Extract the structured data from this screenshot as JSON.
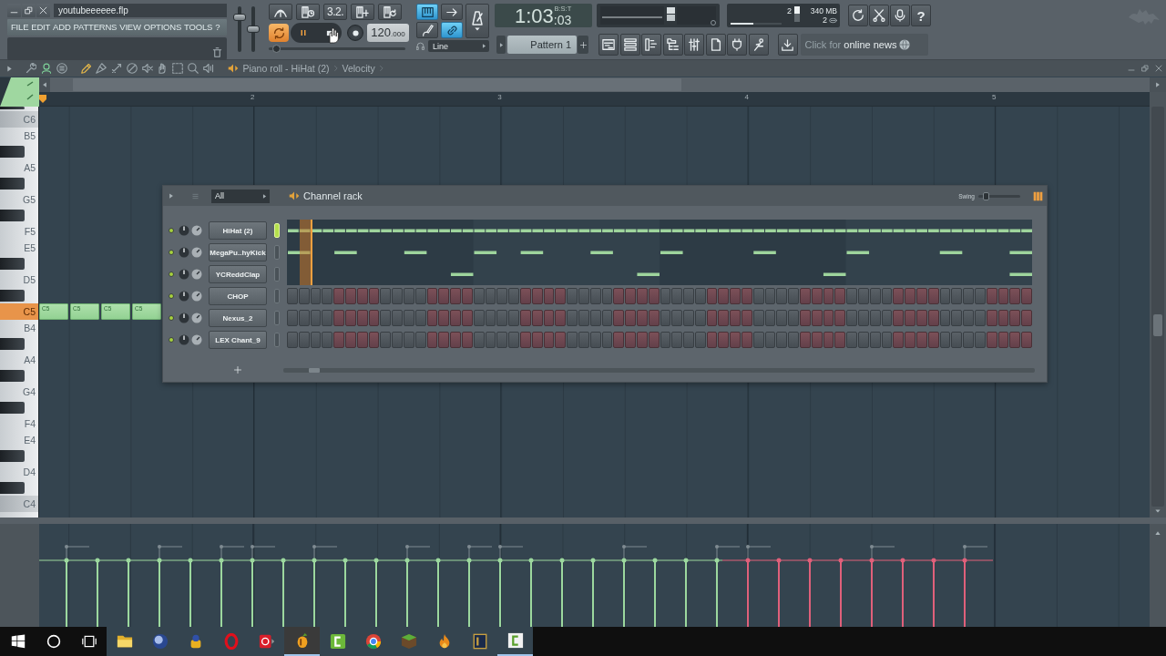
{
  "window": {
    "title": "youtubeeeeee.flp"
  },
  "menu": [
    "FILE",
    "EDIT",
    "ADD",
    "PATTERNS",
    "VIEW",
    "OPTIONS",
    "TOOLS",
    "?"
  ],
  "master": {
    "volume": {
      "level": 0.8
    },
    "pitch": {
      "level": 0.5
    }
  },
  "transport": {
    "countdown": "3.2.",
    "loop": {
      "on": true
    },
    "playing": true,
    "tempo": {
      "whole": "120",
      "fraction": ".000"
    },
    "position": {
      "level": 0.03
    }
  },
  "record_options": [
    {
      "on": true
    },
    {
      "on": false
    },
    {
      "on": false
    },
    {
      "on": true
    }
  ],
  "snap": "Line",
  "time": {
    "main": "1:03",
    "fraction": ":03",
    "format": "B:S:T"
  },
  "meters": {
    "value_1": "2",
    "memory": "340 MB",
    "value_2": "2",
    "cpu": {
      "level": 0.45
    },
    "ram": {
      "level": 0.45
    }
  },
  "help_button": "?",
  "pattern": "Pattern 1",
  "news": "Click for **online news**",
  "piano_roll": {
    "toggles": [
      {
        "on": false
      },
      {
        "on": true
      },
      {
        "on": false
      }
    ],
    "tools": [
      {
        "selected": true
      },
      {
        "selected": false
      },
      {
        "selected": false
      },
      {
        "selected": false
      },
      {
        "selected": false
      },
      {
        "selected": false
      },
      {
        "selected": false
      },
      {
        "selected": false
      },
      {
        "selected": false
      }
    ],
    "title": "Piano roll - HiHat (2)",
    "target": "Velocity",
    "bars": [
      "2",
      "3",
      "4",
      "5"
    ],
    "keys": [
      {
        "kind": "black",
        "active": false
      },
      {
        "kind": "octave",
        "label": "C6",
        "active": false
      },
      {
        "kind": "white",
        "label": "B5",
        "active": false
      },
      {
        "kind": "black",
        "active": false
      },
      {
        "kind": "white",
        "label": "A5",
        "active": false
      },
      {
        "kind": "black",
        "active": false
      },
      {
        "kind": "white",
        "label": "G5",
        "active": false
      },
      {
        "kind": "black",
        "active": false
      },
      {
        "kind": "white",
        "label": "F5",
        "active": false
      },
      {
        "kind": "white",
        "label": "E5",
        "active": false
      },
      {
        "kind": "black",
        "active": false
      },
      {
        "kind": "white",
        "label": "D5",
        "active": false
      },
      {
        "kind": "black",
        "active": false
      },
      {
        "kind": "octave",
        "label": "C5",
        "active": true
      },
      {
        "kind": "white",
        "label": "B4",
        "active": false
      },
      {
        "kind": "black",
        "active": false
      },
      {
        "kind": "white",
        "label": "A4",
        "active": false
      },
      {
        "kind": "black",
        "active": false
      },
      {
        "kind": "white",
        "label": "G4",
        "active": false
      },
      {
        "kind": "black",
        "active": false
      },
      {
        "kind": "white",
        "label": "F4",
        "active": false
      },
      {
        "kind": "white",
        "label": "E4",
        "active": false
      },
      {
        "kind": "black",
        "active": false
      },
      {
        "kind": "white",
        "label": "D4",
        "active": false
      },
      {
        "kind": "black",
        "active": false
      },
      {
        "kind": "octave",
        "label": "C4",
        "active": false
      },
      {
        "kind": "white",
        "active": false
      }
    ],
    "notes": [
      {
        "label": "C5"
      },
      {
        "label": "C5"
      },
      {
        "label": "C5"
      },
      {
        "label": "C5"
      }
    ]
  },
  "channel_rack": {
    "filter": "All",
    "title": "Channel rack",
    "swing_label": "Swing",
    "swing": {
      "level": 0.12
    },
    "channels": [
      {
        "name": "HiHat (2)",
        "kind": "preview",
        "enabled": true,
        "selected": true
      },
      {
        "name": "MegaPu..hyKick",
        "kind": "preview",
        "enabled": true,
        "selected": false
      },
      {
        "name": "YCReddClap",
        "kind": "preview",
        "enabled": true,
        "selected": false
      },
      {
        "name": "CHOP",
        "kind": "steps",
        "enabled": true,
        "selected": false
      },
      {
        "name": "Nexus_2",
        "kind": "steps",
        "enabled": true,
        "selected": false
      },
      {
        "name": "LEX Chant_9",
        "kind": "steps",
        "enabled": true,
        "selected": false
      }
    ]
  },
  "taskbar": {
    "apps": [
      {
        "active": false,
        "running": false
      },
      {
        "active": false,
        "running": false
      },
      {
        "active": false,
        "running": false
      },
      {
        "active": false,
        "running": false
      },
      {
        "active": false,
        "running": false
      },
      {
        "active": true,
        "running": true
      },
      {
        "active": false,
        "running": false
      },
      {
        "active": false,
        "running": false
      },
      {
        "active": false,
        "running": false
      },
      {
        "active": false,
        "running": false
      },
      {
        "active": false,
        "running": false
      },
      {
        "active": false,
        "running": true
      }
    ]
  }
}
